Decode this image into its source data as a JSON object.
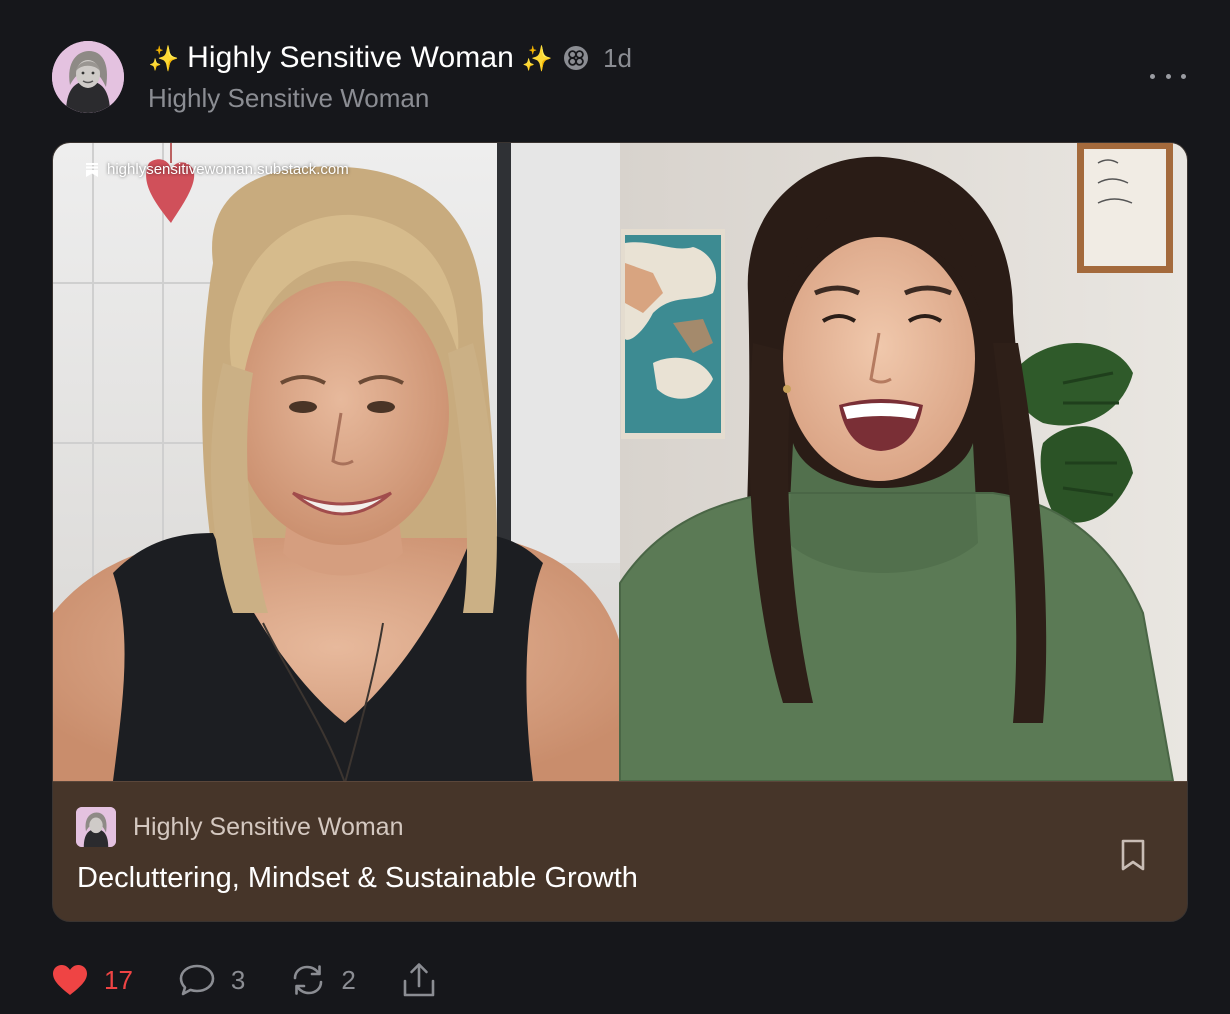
{
  "post": {
    "sparkle_left": "✨",
    "author": "Highly Sensitive Woman",
    "sparkle_right": "✨",
    "timestamp": "1d",
    "publication": "Highly Sensitive Woman"
  },
  "video": {
    "watermark": "highlysensitivewoman.substack.com"
  },
  "card": {
    "publication": "Highly Sensitive Woman",
    "title": "Decluttering, Mindset & Sustainable Growth"
  },
  "actions": {
    "likes": "17",
    "comments": "3",
    "restacks": "2"
  },
  "icons": {
    "more": "more-horizontal-icon",
    "badge": "subscriber-badge-icon",
    "bookmark": "bookmark-icon",
    "like": "heart-icon",
    "comment": "comment-icon",
    "restack": "restack-icon",
    "share": "share-icon"
  },
  "colors": {
    "background": "#16171b",
    "card_footer": "#463529",
    "like_active": "#ef4444",
    "muted_text": "#8b8d93"
  }
}
